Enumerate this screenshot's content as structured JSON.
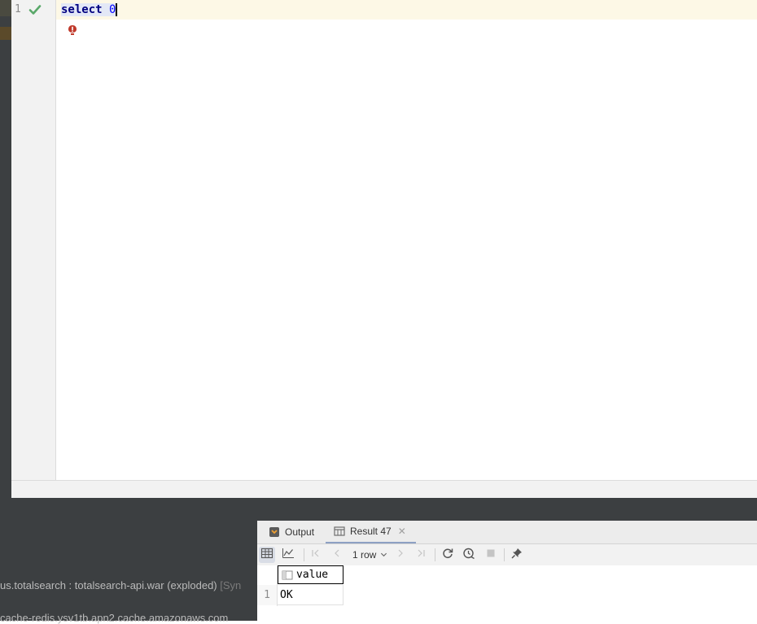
{
  "editor": {
    "line_number": "1",
    "code_keyword": "select",
    "code_value": "0"
  },
  "services": {
    "row1_text": "us.totalsearch : totalsearch-api.war (exploded)",
    "row1_suffix": "[Syn",
    "row2_text": "cache-redis.ysv1tb.apn2.cache.amazonaws.com"
  },
  "results": {
    "tabs": [
      {
        "label": "Output",
        "icon": "output-icon"
      },
      {
        "label": "Result 47",
        "icon": "table-icon",
        "active": true
      }
    ],
    "toolbar": {
      "row_count": "1 row"
    },
    "columns": [
      "value"
    ],
    "rows": [
      {
        "num": "1",
        "cells": [
          "OK"
        ]
      }
    ]
  },
  "colors": {
    "keyword": "#000080",
    "number": "#0000ff",
    "check": "#59a869",
    "panel_dark": "#3c3f41"
  }
}
